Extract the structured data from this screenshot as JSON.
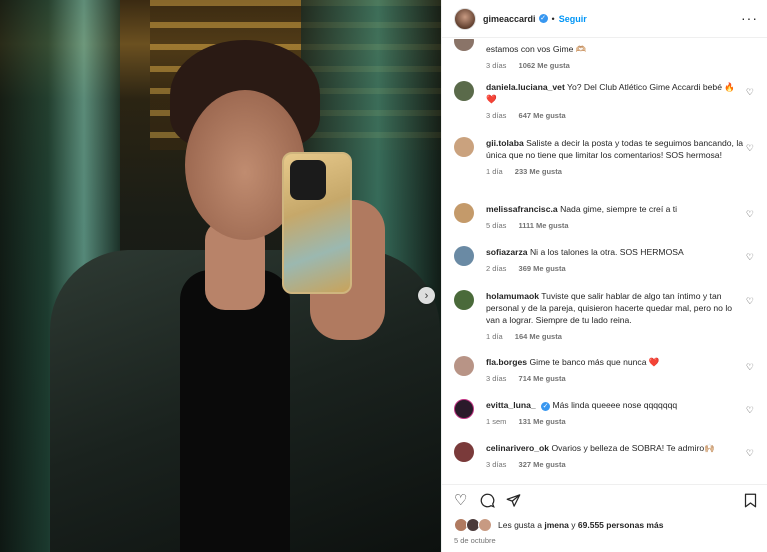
{
  "post": {
    "username": "gimeaccardi",
    "verified_icon": "verified-badge-icon",
    "follow_label": "Seguir",
    "separator": "•",
    "more_label": "···"
  },
  "photo": {
    "next_label": "›"
  },
  "comments": [
    {
      "user": "",
      "text": "estamos con vos Gime 🫶🏼",
      "time": "3 días",
      "likes": "1062 Me gusta",
      "avatar_color": "#8a7468"
    },
    {
      "user": "daniela.luciana_vet",
      "text": "Yo? Del Club Atlético Gime Accardi bebé 🔥❤️",
      "time": "3 días",
      "likes": "647 Me gusta",
      "avatar_color": "#5a6a4a"
    },
    {
      "user": "gii.tolaba",
      "text": "Saliste a decir la posta y todas te seguimos bancando, la única que no tiene que limitar los comentarios! SOS hermosa!",
      "time": "1 día",
      "likes": "233 Me gusta",
      "avatar_color": "#caa27e"
    },
    {
      "user": "melissafrancisc.a",
      "text": "Nada gime, siempre te creí a ti",
      "time": "5 días",
      "likes": "1111 Me gusta",
      "avatar_color": "#c49a6a"
    },
    {
      "user": "sofiazarza",
      "text": "Ni a los talones la otra. SOS HERMOSA",
      "time": "2 días",
      "likes": "369 Me gusta",
      "avatar_color": "#6a8aa4"
    },
    {
      "user": "holamumaok",
      "text": "Tuviste que salir hablar de algo tan íntimo y tan personal y de la pareja, quisieron hacerte quedar mal, pero no lo van a lograr. Siempre de tu lado reina.",
      "time": "1 día",
      "likes": "164 Me gusta",
      "avatar_color": "#4a6a3a"
    },
    {
      "user": "fla.borges",
      "text": "Gime te banco más que nunca ❤️",
      "time": "3 días",
      "likes": "714 Me gusta",
      "avatar_color": "#b89486"
    },
    {
      "user": "evitta_luna_",
      "text": "Más linda queeee nose qqqqqqq",
      "time": "1 sem",
      "likes": "131 Me gusta",
      "avatar_color": "#2a1a2a",
      "verified": true
    },
    {
      "user": "celinarivero_ok",
      "text": "Ovarios y belleza de SOBRA! Te admiro🙌🏼",
      "time": "3 días",
      "likes": "327 Me gusta",
      "avatar_color": "#7a3a3a"
    }
  ],
  "actions": {
    "like_icon": "heart-outline-icon",
    "comment_icon": "comment-bubble-icon",
    "share_icon": "paper-plane-icon",
    "save_icon": "bookmark-icon"
  },
  "likes_summary": {
    "prefix": "Les gusta a",
    "user": "jmena",
    "middle": "y",
    "count": "69.555 personas más"
  },
  "date": "5 de octubre",
  "colors": {
    "accent": "#0095f6",
    "verified": "#3897f0",
    "heart_red": "#ed4956",
    "muted": "#737373"
  }
}
